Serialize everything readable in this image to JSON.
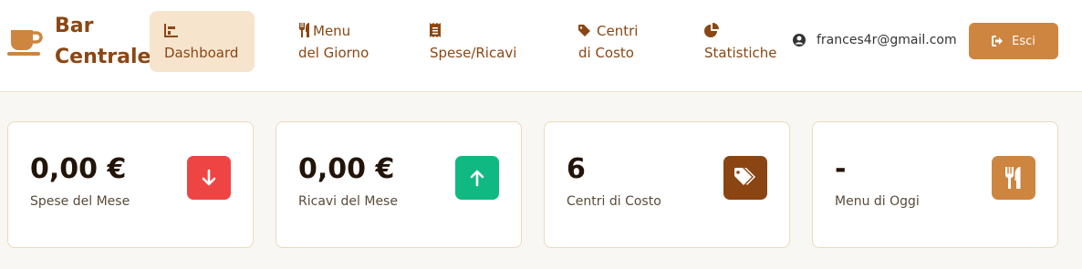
{
  "brand": {
    "line1": "Bar",
    "line2": "Centrale",
    "icon": "coffee-cup-icon"
  },
  "nav": {
    "dashboard": {
      "label": "Dashboard",
      "icon": "bar-chart-icon"
    },
    "menu": {
      "line1": "Menu",
      "line2": "del Giorno",
      "icon": "utensils-icon"
    },
    "spese": {
      "label": "Spese/Ricavi",
      "icon": "receipt-icon"
    },
    "centri": {
      "line1": "Centri",
      "line2": "di Costo",
      "icon": "tags-icon"
    },
    "statistiche": {
      "label": "Statistiche",
      "icon": "pie-chart-icon"
    }
  },
  "user": {
    "email": "frances4r@gmail.com",
    "icon": "user-circle-icon"
  },
  "logout": {
    "label": "Esci",
    "icon": "sign-out-icon"
  },
  "cards": [
    {
      "value": "0,00 €",
      "label": "Spese del Mese",
      "icon": "arrow-down-icon",
      "color": "#ef4444"
    },
    {
      "value": "0,00 €",
      "label": "Ricavi del Mese",
      "icon": "arrow-up-icon",
      "color": "#10b981"
    },
    {
      "value": "6",
      "label": "Centri di Costo",
      "icon": "tags-icon",
      "color": "#8b4513"
    },
    {
      "value": "-",
      "label": "Menu di Oggi",
      "icon": "utensils-icon",
      "color": "#cd853f"
    }
  ],
  "colors": {
    "brand": "#8a4714",
    "accent": "#cd853f",
    "active_bg": "#f6e4cd"
  }
}
